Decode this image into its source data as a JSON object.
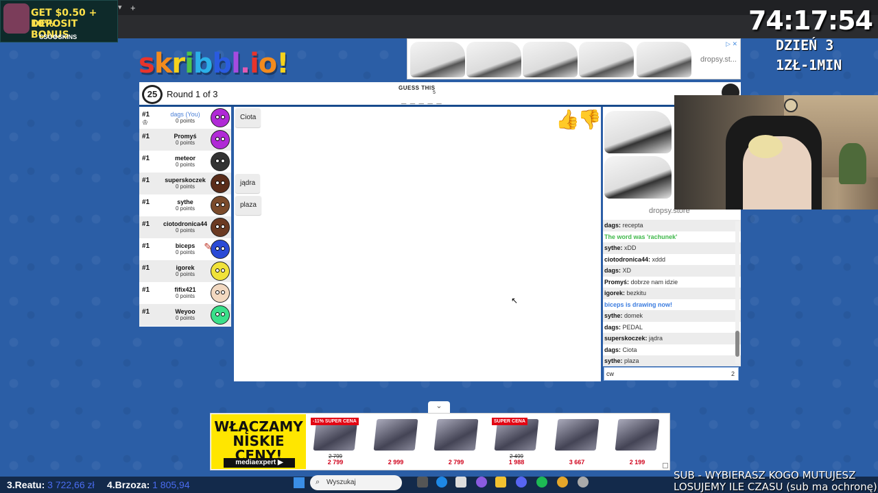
{
  "browser": {
    "new_tab": "+",
    "tab_arrow": "▾"
  },
  "promo": {
    "line1": "GET $0.50 + 10%",
    "line2": "DEPOSIT BONUS",
    "brand": "CSG⚙SKINS"
  },
  "overlay": {
    "timer": "74:17:54",
    "day": "DZIEŃ 3",
    "rate": "1ZŁ-1MIN"
  },
  "logo": {
    "letters": [
      "s",
      "k",
      "r",
      "i",
      "b",
      "b",
      "l",
      ".",
      "i",
      "o",
      "!"
    ],
    "colors": [
      "#e8342b",
      "#f28b1e",
      "#f6d21c",
      "#4fc24a",
      "#2bb0e8",
      "#2a5be0",
      "#a64be0",
      "#e05ab4",
      "#e8342b",
      "#f28b1e",
      "#f6d21c"
    ]
  },
  "top_ad": {
    "site": "dropsy.st...",
    "icons": "▷ ✕"
  },
  "header": {
    "timer": "25",
    "round": "Round 1 of 3",
    "guess_label": "GUESS THIS",
    "guess_length": "5",
    "blanks": "_ _ _ _ _"
  },
  "players": [
    {
      "rank": "#1",
      "name": "dags (You)",
      "points": "0 points",
      "you": true,
      "crown": "♔",
      "color": "#b02ad6"
    },
    {
      "rank": "#1",
      "name": "Promyś",
      "points": "0 points",
      "color": "#b02ad6"
    },
    {
      "rank": "#1",
      "name": "meteor",
      "points": "0 points",
      "color": "#333333"
    },
    {
      "rank": "#1",
      "name": "superskoczek",
      "points": "0 points",
      "color": "#5a2d1a"
    },
    {
      "rank": "#1",
      "name": "sythe",
      "points": "0 points",
      "color": "#7a4a2a"
    },
    {
      "rank": "#1",
      "name": "ciotodronica44",
      "points": "0 points",
      "color": "#6b3a22"
    },
    {
      "rank": "#1",
      "name": "biceps",
      "points": "0 points",
      "color": "#2a4ad6",
      "drawing": true
    },
    {
      "rank": "#1",
      "name": "igorek",
      "points": "0 points",
      "color": "#f0e23a"
    },
    {
      "rank": "#1",
      "name": "fifix421",
      "points": "0 points",
      "color": "#f2d8c0"
    },
    {
      "rank": "#1",
      "name": "Weyoo",
      "points": "0 points",
      "color": "#3ae08a"
    }
  ],
  "canvas_guesses": [
    "Ciota",
    "jądra",
    "plaza"
  ],
  "side_ad": {
    "site": "dropsy.store"
  },
  "chat": [
    {
      "user": "dags",
      "msg": "recepta",
      "style": "normal"
    },
    {
      "text": "The word was 'rachunek'",
      "style": "green"
    },
    {
      "user": "sythe",
      "msg": "xDD",
      "style": "normal"
    },
    {
      "user": "ciotodronica44",
      "msg": "xddd",
      "style": "normal"
    },
    {
      "user": "dags",
      "msg": "XD",
      "style": "normal"
    },
    {
      "user": "Promyś",
      "msg": "dobrze nam idzie",
      "style": "normal"
    },
    {
      "user": "igorek",
      "msg": "bezkitu",
      "style": "normal"
    },
    {
      "text": "biceps is drawing now!",
      "style": "blue"
    },
    {
      "user": "sythe",
      "msg": "domek",
      "style": "normal"
    },
    {
      "user": "dags",
      "msg": "PEDAL",
      "style": "normal"
    },
    {
      "user": "superskoczek",
      "msg": "jądra",
      "style": "normal"
    },
    {
      "user": "dags",
      "msg": "Ciota",
      "style": "normal"
    },
    {
      "user": "sythe",
      "msg": "plaza",
      "style": "normal"
    }
  ],
  "chat_input": {
    "value": "cw",
    "count": "2"
  },
  "bottom_ad": {
    "headline": "WŁĄCZAMY NISKIE CENY!",
    "brand": "mediaexpert ▶",
    "products": [
      {
        "badge": "-11% SUPER CENA",
        "old": "2 799",
        "price": "2 799"
      },
      {
        "badge": "",
        "old": "",
        "price": "2 999"
      },
      {
        "badge": "",
        "old": "",
        "price": "2 799"
      },
      {
        "badge": "SUPER CENA",
        "old": "2 499",
        "price": "1 988"
      },
      {
        "badge": "",
        "old": "",
        "price": "3 667"
      },
      {
        "badge": "",
        "old": "",
        "price": "2 199"
      }
    ]
  },
  "ranks": {
    "r3_label": "3.Reatu:",
    "r3_amount": "3 722,66 zł",
    "r4_label": "4.Brzoza:",
    "r4_amount": "1 805,94"
  },
  "taskbar": {
    "search": "Wyszukaj"
  },
  "sub": {
    "line1": "SUB - WYBIERASZ KOGO MUTUJESZ",
    "line2": "LOSUJEMY ILE CZASU (sub ma ochronę)"
  }
}
